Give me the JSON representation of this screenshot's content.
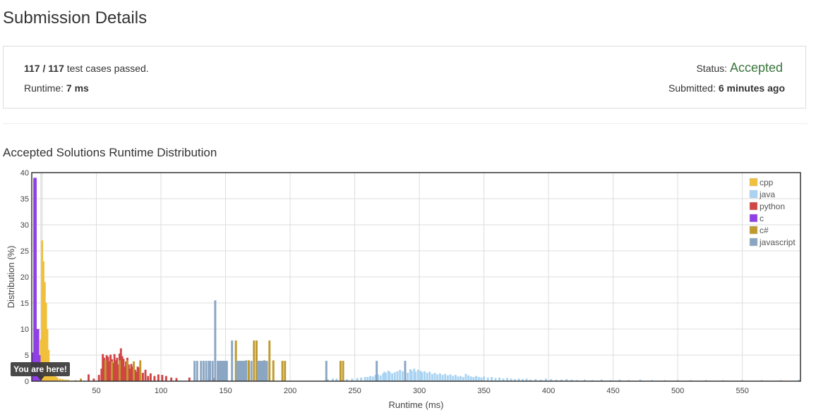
{
  "page": {
    "title": "Submission Details"
  },
  "summary": {
    "passed": "117",
    "separator": " / ",
    "total": "117",
    "cases_suffix": " test cases passed.",
    "runtime_label": "Runtime: ",
    "runtime_value": "7 ms",
    "status_label": "Status: ",
    "status_value": "Accepted",
    "status_color": "#3c763d",
    "submitted_label": "Submitted: ",
    "submitted_value": "6 minutes ago"
  },
  "section": {
    "title": "Accepted Solutions Runtime Distribution"
  },
  "chart_data": {
    "type": "bar",
    "title": "",
    "xlabel": "Runtime (ms)",
    "ylabel": "Distribution (%)",
    "xlim": [
      0,
      595
    ],
    "ylim": [
      0,
      40
    ],
    "x_ticks": [
      50,
      100,
      150,
      200,
      250,
      300,
      350,
      400,
      450,
      500,
      550
    ],
    "y_ticks": [
      0,
      5,
      10,
      15,
      20,
      25,
      30,
      35,
      40
    ],
    "grid": true,
    "legend_position": "top-right",
    "bin_width_ms": 1,
    "highlight": {
      "x": 7,
      "label": "You are here!"
    },
    "series": [
      {
        "name": "cpp",
        "color": "#f0c03c",
        "points": [
          [
            7,
            8
          ],
          [
            8,
            27
          ],
          [
            9,
            23
          ],
          [
            10,
            19
          ],
          [
            11,
            15
          ],
          [
            12,
            10
          ],
          [
            13,
            6
          ],
          [
            14,
            3
          ],
          [
            15,
            2
          ],
          [
            16,
            1.5
          ],
          [
            17,
            1
          ],
          [
            18,
            1
          ],
          [
            19,
            0.8
          ],
          [
            20,
            0.6
          ],
          [
            22,
            0.5
          ],
          [
            24,
            0.4
          ],
          [
            26,
            0.3
          ],
          [
            28,
            0.3
          ],
          [
            34,
            0.2
          ]
        ]
      },
      {
        "name": "java",
        "color": "#a9d3f2",
        "points": [
          [
            229,
            0.4
          ],
          [
            233,
            0.5
          ],
          [
            236,
            0.5
          ],
          [
            244,
            0.4
          ],
          [
            248,
            0.5
          ],
          [
            252,
            0.6
          ],
          [
            255,
            0.7
          ],
          [
            258,
            0.8
          ],
          [
            260,
            0.8
          ],
          [
            262,
            1.0
          ],
          [
            264,
            0.9
          ],
          [
            266,
            1.2
          ],
          [
            268,
            1.3
          ],
          [
            270,
            1.1
          ],
          [
            272,
            1.5
          ],
          [
            273,
            1.8
          ],
          [
            274,
            1.6
          ],
          [
            276,
            2.0
          ],
          [
            277,
            1.8
          ],
          [
            279,
            1.5
          ],
          [
            281,
            1.7
          ],
          [
            283,
            1.9
          ],
          [
            285,
            2.2
          ],
          [
            287,
            1.9
          ],
          [
            289,
            2.1
          ],
          [
            291,
            1.6
          ],
          [
            293,
            2.3
          ],
          [
            294,
            2.0
          ],
          [
            296,
            2.4
          ],
          [
            297,
            1.8
          ],
          [
            299,
            2.2
          ],
          [
            301,
            2.0
          ],
          [
            302,
            1.7
          ],
          [
            304,
            1.9
          ],
          [
            306,
            1.6
          ],
          [
            308,
            1.8
          ],
          [
            310,
            1.4
          ],
          [
            312,
            1.6
          ],
          [
            314,
            1.3
          ],
          [
            316,
            1.5
          ],
          [
            318,
            1.2
          ],
          [
            320,
            1.4
          ],
          [
            322,
            1.1
          ],
          [
            324,
            1.3
          ],
          [
            326,
            1.0
          ],
          [
            328,
            1.2
          ],
          [
            330,
            0.9
          ],
          [
            332,
            1.0
          ],
          [
            334,
            0.8
          ],
          [
            336,
            1.4
          ],
          [
            338,
            1.1
          ],
          [
            340,
            0.9
          ],
          [
            342,
            0.8
          ],
          [
            344,
            1.0
          ],
          [
            346,
            0.8
          ],
          [
            348,
            0.7
          ],
          [
            350,
            0.9
          ],
          [
            353,
            0.7
          ],
          [
            356,
            0.8
          ],
          [
            359,
            0.6
          ],
          [
            362,
            0.7
          ],
          [
            365,
            0.5
          ],
          [
            368,
            0.6
          ],
          [
            371,
            0.5
          ],
          [
            374,
            0.4
          ],
          [
            377,
            0.5
          ],
          [
            380,
            0.4
          ],
          [
            383,
            0.5
          ],
          [
            386,
            0.3
          ],
          [
            390,
            0.4
          ],
          [
            394,
            0.3
          ],
          [
            398,
            0.5
          ],
          [
            402,
            0.4
          ],
          [
            406,
            0.3
          ],
          [
            410,
            0.3
          ],
          [
            414,
            0.4
          ],
          [
            418,
            0.3
          ],
          [
            422,
            0.2
          ],
          [
            428,
            0.3
          ],
          [
            434,
            0.2
          ],
          [
            441,
            0.3
          ],
          [
            448,
            0.2
          ],
          [
            455,
            0.3
          ],
          [
            462,
            0.2
          ],
          [
            471,
            0.3
          ],
          [
            480,
            0.2
          ],
          [
            490,
            0.2
          ],
          [
            500,
            0.2
          ],
          [
            510,
            0.2
          ],
          [
            522,
            0.2
          ],
          [
            535,
            0.2
          ],
          [
            550,
            0.2
          ],
          [
            565,
            0.2
          ],
          [
            580,
            0.2
          ],
          [
            594,
            0.3
          ]
        ]
      },
      {
        "name": "python",
        "color": "#d04545",
        "points": [
          [
            44,
            1.3
          ],
          [
            48,
            0.5
          ],
          [
            52,
            1.2
          ],
          [
            54,
            2.4
          ],
          [
            55,
            5.2
          ],
          [
            56,
            4.5
          ],
          [
            57,
            3.6
          ],
          [
            58,
            5.0
          ],
          [
            59,
            4.7
          ],
          [
            60,
            3.8
          ],
          [
            61,
            5.1
          ],
          [
            62,
            4.2
          ],
          [
            63,
            3.5
          ],
          [
            64,
            5.2
          ],
          [
            65,
            4.0
          ],
          [
            66,
            4.5
          ],
          [
            67,
            3.2
          ],
          [
            68,
            5.3
          ],
          [
            69,
            6.3
          ],
          [
            70,
            4.8
          ],
          [
            71,
            4.3
          ],
          [
            72,
            2.8
          ],
          [
            73,
            3.8
          ],
          [
            74,
            4.5
          ],
          [
            75,
            3.2
          ],
          [
            76,
            2.4
          ],
          [
            77,
            3.3
          ],
          [
            78,
            2.8
          ],
          [
            79,
            3.2
          ],
          [
            80,
            2.2
          ],
          [
            81,
            1.8
          ],
          [
            82,
            2.8
          ],
          [
            83,
            2.6
          ],
          [
            84,
            1.5
          ],
          [
            86,
            1.6
          ],
          [
            88,
            2.2
          ],
          [
            90,
            1.0
          ],
          [
            92,
            1.5
          ],
          [
            95,
            1.0
          ],
          [
            98,
            1.3
          ],
          [
            101,
            1.2
          ],
          [
            104,
            1.0
          ],
          [
            108,
            0.7
          ],
          [
            112,
            0.6
          ],
          [
            122,
            0.7
          ],
          [
            137,
            0.6
          ],
          [
            141,
            0.6
          ]
        ]
      },
      {
        "name": "c",
        "color": "#8f3fe5",
        "points": [
          [
            1,
            5.5
          ],
          [
            2,
            39
          ],
          [
            3,
            39
          ],
          [
            4,
            10
          ],
          [
            5,
            10
          ],
          [
            6,
            5
          ],
          [
            7,
            2
          ]
        ]
      },
      {
        "name": "c#",
        "color": "#bf9a2d",
        "points": [
          [
            38,
            0.5
          ],
          [
            57,
            4.0
          ],
          [
            62,
            3.8
          ],
          [
            68,
            4.0
          ],
          [
            74,
            4.0
          ],
          [
            79,
            3.8
          ],
          [
            84,
            4.0
          ],
          [
            158,
            7.8
          ],
          [
            166,
            4.0
          ],
          [
            168,
            4.0
          ],
          [
            172,
            7.8
          ],
          [
            174,
            7.8
          ],
          [
            180,
            4.0
          ],
          [
            184,
            7.8
          ],
          [
            187,
            4.0
          ],
          [
            194,
            3.9
          ],
          [
            196,
            3.9
          ],
          [
            239,
            3.9
          ],
          [
            241,
            3.9
          ]
        ]
      },
      {
        "name": "javascript",
        "color": "#8aa6c3",
        "points": [
          [
            126,
            3.9
          ],
          [
            128,
            3.9
          ],
          [
            131,
            3.9
          ],
          [
            133,
            3.9
          ],
          [
            135,
            3.9
          ],
          [
            137,
            3.9
          ],
          [
            138,
            3.9
          ],
          [
            140,
            3.9
          ],
          [
            142,
            15.5
          ],
          [
            144,
            3.9
          ],
          [
            145,
            3.9
          ],
          [
            146,
            3.9
          ],
          [
            147,
            3.9
          ],
          [
            148,
            3.9
          ],
          [
            149,
            3.9
          ],
          [
            150,
            3.9
          ],
          [
            151,
            3.9
          ],
          [
            155,
            7.8
          ],
          [
            159,
            3.9
          ],
          [
            160,
            3.9
          ],
          [
            161,
            3.9
          ],
          [
            162,
            3.9
          ],
          [
            163,
            3.9
          ],
          [
            164,
            3.9
          ],
          [
            165,
            3.9
          ],
          [
            166,
            3.9
          ],
          [
            170,
            3.9
          ],
          [
            175,
            3.9
          ],
          [
            176,
            3.9
          ],
          [
            177,
            3.9
          ],
          [
            178,
            3.9
          ],
          [
            179,
            3.9
          ],
          [
            180,
            3.9
          ],
          [
            181,
            3.9
          ],
          [
            182,
            3.9
          ],
          [
            228,
            3.9
          ],
          [
            267,
            3.9
          ],
          [
            289,
            3.9
          ]
        ]
      }
    ]
  }
}
